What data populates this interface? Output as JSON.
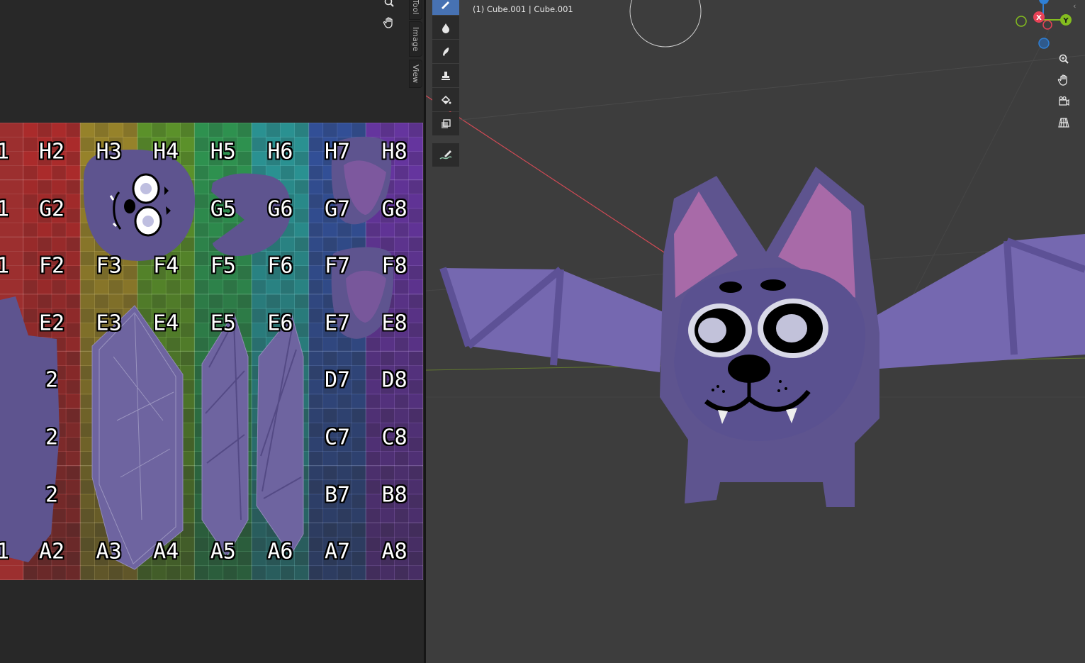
{
  "uv_editor": {
    "side_tabs": [
      "Tool",
      "Image",
      "View"
    ],
    "grid": {
      "columns": [
        "1",
        "2",
        "3",
        "4",
        "5",
        "6",
        "7",
        "8"
      ],
      "rows": [
        "H",
        "G",
        "F",
        "E",
        "D",
        "C",
        "B",
        "A"
      ],
      "column_colors": [
        "#b52b2b",
        "#a08a2a",
        "#5f9a2a",
        "#2f9a53",
        "#2a9a9a",
        "#3353a0",
        "#6a36a8",
        "#a834a0"
      ],
      "visible_labels": [
        {
          "text": "1",
          "col": 0,
          "row": 0
        },
        {
          "text": "H2",
          "col": 1,
          "row": 0
        },
        {
          "text": "H3",
          "col": 2,
          "row": 0
        },
        {
          "text": "H4",
          "col": 3,
          "row": 0
        },
        {
          "text": "H5",
          "col": 4,
          "row": 0
        },
        {
          "text": "H6",
          "col": 5,
          "row": 0
        },
        {
          "text": "H7",
          "col": 6,
          "row": 0
        },
        {
          "text": "H8",
          "col": 7,
          "row": 0
        },
        {
          "text": "1",
          "col": 0,
          "row": 1
        },
        {
          "text": "G2",
          "col": 1,
          "row": 1
        },
        {
          "text": "G5",
          "col": 4,
          "row": 1
        },
        {
          "text": "G6",
          "col": 5,
          "row": 1
        },
        {
          "text": "G7",
          "col": 6,
          "row": 1
        },
        {
          "text": "G8",
          "col": 7,
          "row": 1
        },
        {
          "text": "1",
          "col": 0,
          "row": 2
        },
        {
          "text": "F2",
          "col": 1,
          "row": 2
        },
        {
          "text": "F3",
          "col": 2,
          "row": 2
        },
        {
          "text": "F4",
          "col": 3,
          "row": 2
        },
        {
          "text": "F5",
          "col": 4,
          "row": 2
        },
        {
          "text": "F6",
          "col": 5,
          "row": 2
        },
        {
          "text": "F7",
          "col": 6,
          "row": 2
        },
        {
          "text": "F8",
          "col": 7,
          "row": 2
        },
        {
          "text": "E2",
          "col": 1,
          "row": 3
        },
        {
          "text": "E3",
          "col": 2,
          "row": 3
        },
        {
          "text": "E4",
          "col": 3,
          "row": 3
        },
        {
          "text": "E5",
          "col": 4,
          "row": 3
        },
        {
          "text": "E6",
          "col": 5,
          "row": 3
        },
        {
          "text": "E7",
          "col": 6,
          "row": 3
        },
        {
          "text": "E8",
          "col": 7,
          "row": 3
        },
        {
          "text": "2",
          "col": 1,
          "row": 4
        },
        {
          "text": "D7",
          "col": 6,
          "row": 4
        },
        {
          "text": "D8",
          "col": 7,
          "row": 4
        },
        {
          "text": "2",
          "col": 1,
          "row": 5
        },
        {
          "text": "C7",
          "col": 6,
          "row": 5
        },
        {
          "text": "C8",
          "col": 7,
          "row": 5
        },
        {
          "text": "2",
          "col": 1,
          "row": 6
        },
        {
          "text": "B7",
          "col": 6,
          "row": 6
        },
        {
          "text": "B8",
          "col": 7,
          "row": 6
        },
        {
          "text": "1",
          "col": 0,
          "row": 7
        },
        {
          "text": "A2",
          "col": 1,
          "row": 7
        },
        {
          "text": "A3",
          "col": 2,
          "row": 7
        },
        {
          "text": "A4",
          "col": 3,
          "row": 7
        },
        {
          "text": "A5",
          "col": 4,
          "row": 7
        },
        {
          "text": "A6",
          "col": 5,
          "row": 7
        },
        {
          "text": "A7",
          "col": 6,
          "row": 7
        },
        {
          "text": "A8",
          "col": 7,
          "row": 7
        }
      ]
    },
    "nav_icons": [
      "zoom-icon",
      "hand-icon"
    ]
  },
  "viewport": {
    "object_label": "(1) Cube.001 | Cube.001",
    "tools": [
      "draw",
      "blur",
      "smear",
      "clone",
      "fill",
      "mask",
      "annotate"
    ],
    "gizmo": {
      "x_label": "X",
      "y_label": "Y",
      "x_color": "#e84257",
      "y_color": "#84bd1f",
      "z_color": "#2f7fd4"
    },
    "nav_icons": [
      "zoom-icon",
      "hand-icon",
      "camera-icon",
      "grid-icon"
    ],
    "model_color": "#5e548f"
  }
}
